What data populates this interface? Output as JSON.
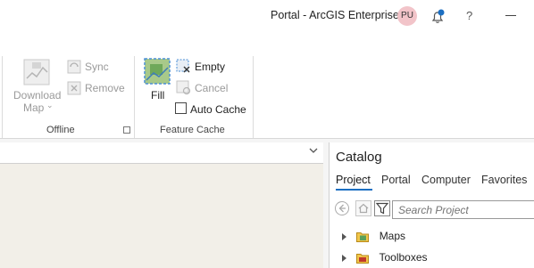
{
  "title_bar": {
    "portal_title": "Portal - ArcGIS Enterprise",
    "user_initials": "PU",
    "help_label": "?"
  },
  "ribbon": {
    "offline_group": {
      "download_map_line1": "Download",
      "download_map_line2": "Map",
      "sync_label": "Sync",
      "remove_label": "Remove",
      "group_label": "Offline"
    },
    "feature_cache_group": {
      "fill_label": "Fill",
      "empty_label": "Empty",
      "cancel_label": "Cancel",
      "auto_cache_label": "Auto Cache",
      "auto_cache_checked": false,
      "group_label": "Feature Cache"
    }
  },
  "catalog": {
    "title": "Catalog",
    "tabs": [
      "Project",
      "Portal",
      "Computer",
      "Favorites"
    ],
    "active_tab": "Project",
    "search_placeholder": "Search Project",
    "tree_items": [
      {
        "label": "Maps",
        "icon": "maps-folder-icon"
      },
      {
        "label": "Toolboxes",
        "icon": "toolboxes-icon"
      }
    ]
  },
  "colors": {
    "accent": "#1c6fc2",
    "avatar_bg": "#f2c4c9",
    "map_canvas": "#f2efe8",
    "disabled_text": "#9a9a9a"
  }
}
